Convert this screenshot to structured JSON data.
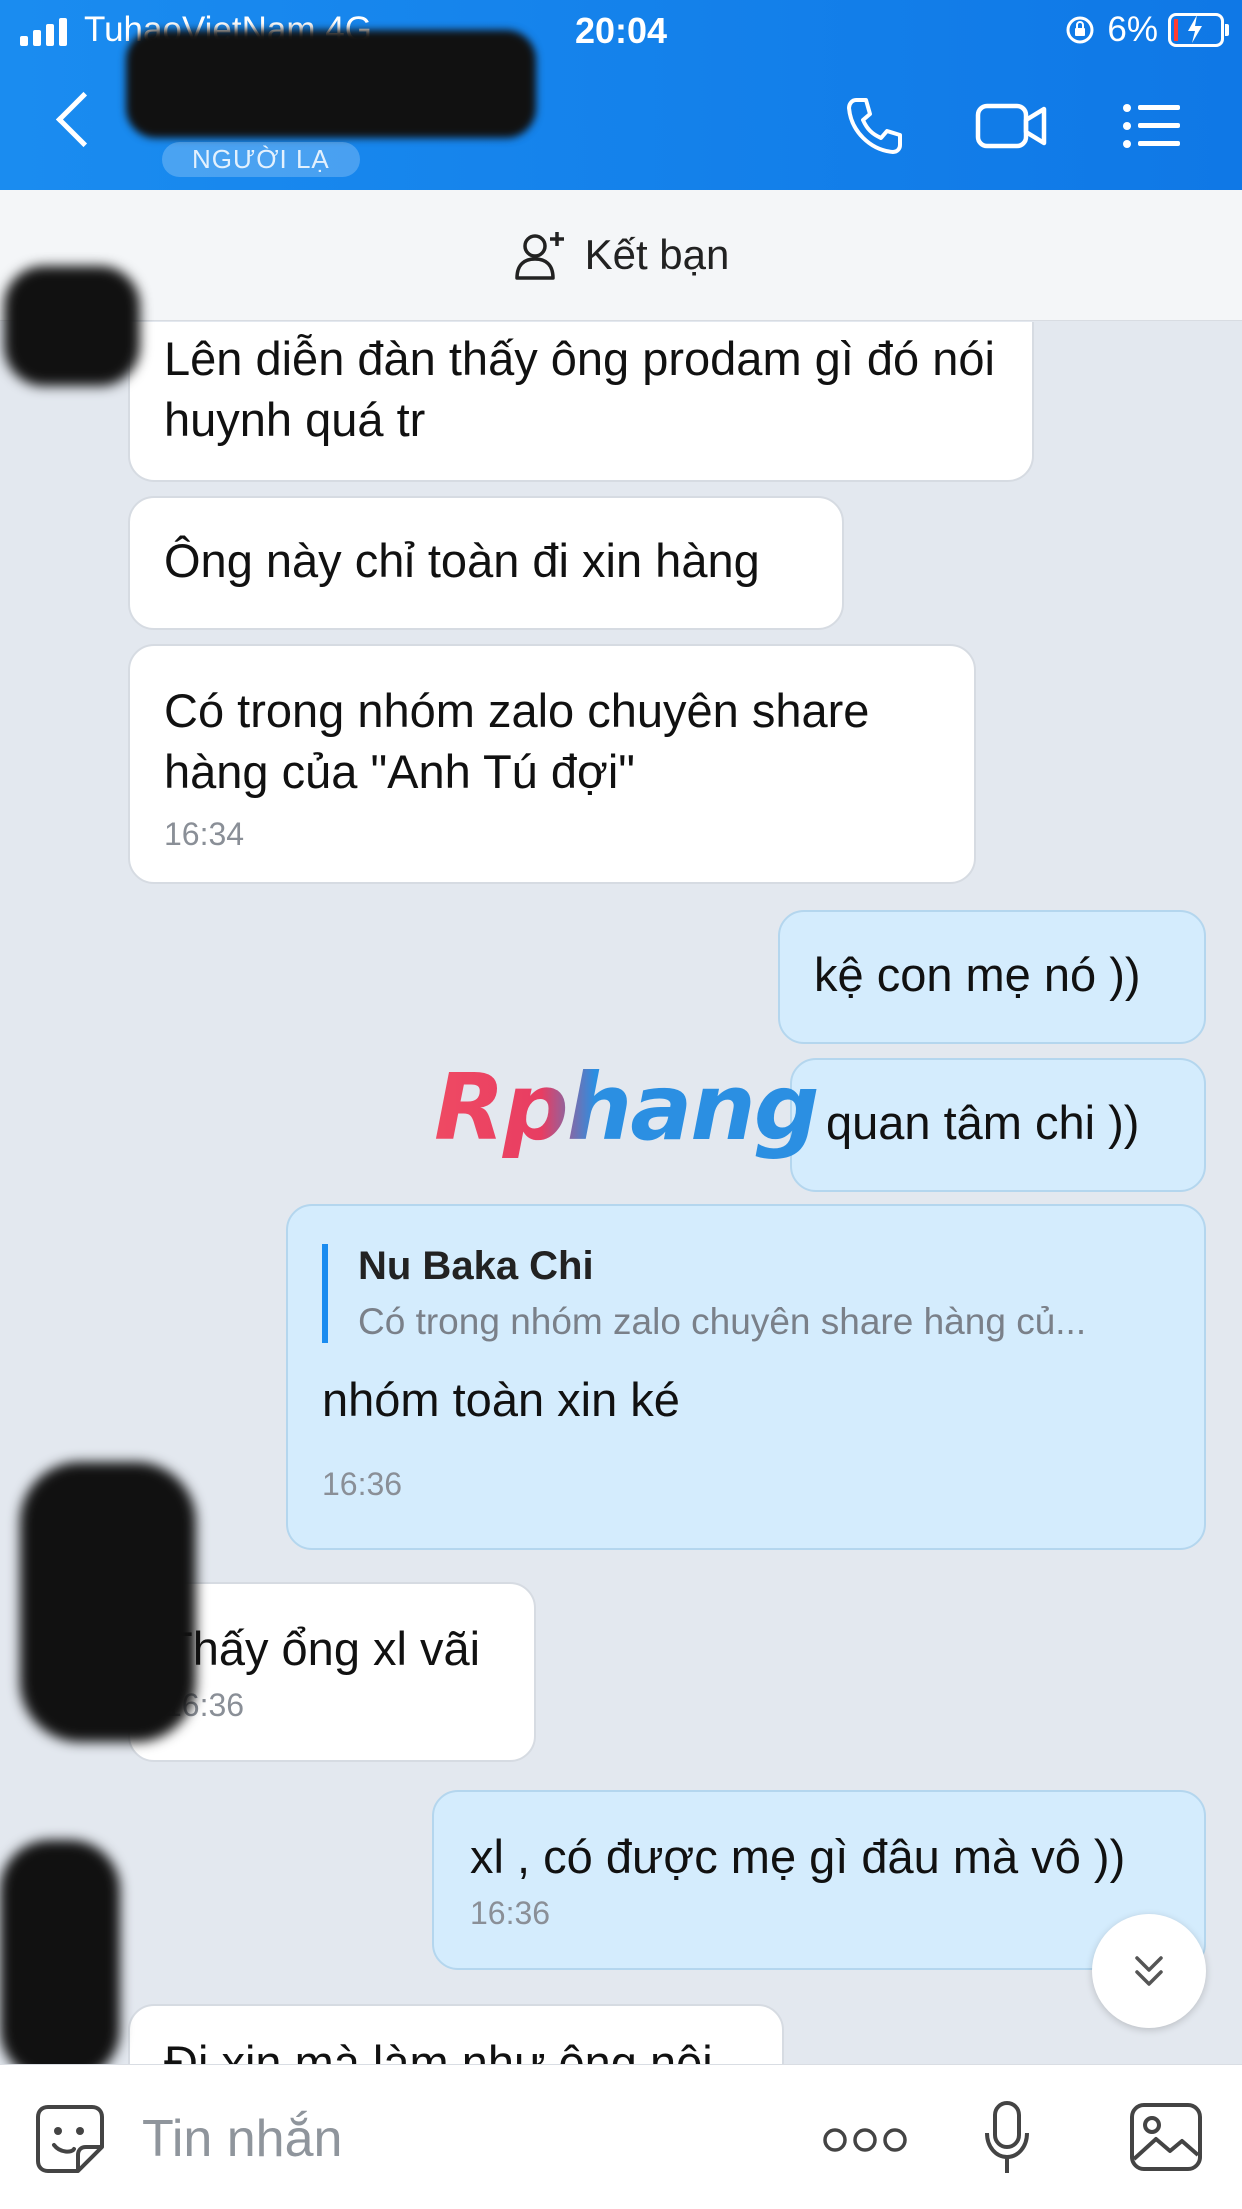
{
  "status": {
    "carrier": "TuhaoVietNam  4G",
    "time": "20:04",
    "battery": "6%"
  },
  "header": {
    "contact_badge": "NGƯỜI LẠ"
  },
  "add_friend": {
    "label": "Kết bạn"
  },
  "watermark": "Rphang",
  "messages": [
    {
      "text": "Lên diễn đàn thấy ông prodam gì đó nói huynh quá tr"
    },
    {
      "text": "Ông này chỉ toàn đi xin hàng"
    },
    {
      "text": "Có trong nhóm zalo chuyên share hàng của \"Anh Tú đợi\"",
      "time": "16:34"
    },
    {
      "text": "kệ con mẹ nó ))"
    },
    {
      "text": "quan tâm chi ))"
    },
    {
      "quote_name": "Nu Baka Chi",
      "quote_text": "Có trong nhóm zalo chuyên share hàng củ...",
      "text": "nhóm toàn xin ké",
      "time": "16:36"
    },
    {
      "text": "Thấy ổng xl vãi",
      "time": "16:36"
    },
    {
      "text": "xl , có được mẹ gì đâu mà vô ))",
      "time": "16:36"
    },
    {
      "text": "Đi xin mà làm như ông nội"
    }
  ],
  "input": {
    "placeholder": "Tin nhắn"
  }
}
